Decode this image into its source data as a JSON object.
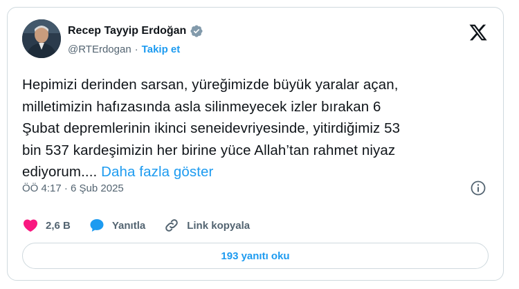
{
  "author": {
    "name": "Recep Tayyip Erdoğan",
    "handle": "@RTErdogan",
    "separator": "·",
    "follow_label": "Takip et"
  },
  "tweet": {
    "text": "Hepimizi derinden sarsan, yüreğimizde büyük yaralar açan,\nmilletimizin hafızasında asla silinmeyecek izler bırakan 6\nŞubat depremlerinin ikinci seneidevriyesinde, yitirdiğimiz 53\nbin 537 kardeşimizin her birine yüce Allah’tan rahmet niyaz\nediyorum....",
    "show_more": "Daha fazla göster",
    "timestamp": "ÖÖ 4:17 · 6 Şub 2025"
  },
  "actions": {
    "likes": "2,6 B",
    "reply_label": "Yanıtla",
    "copy_link_label": "Link kopyala"
  },
  "read_replies": "193 yanıtı oku",
  "icons": {
    "verified": "verified-badge-icon",
    "x_logo": "x-logo-icon",
    "info": "info-icon",
    "heart": "heart-icon",
    "reply": "speech-bubble-icon",
    "link": "link-icon"
  },
  "colors": {
    "accent": "#1d9bf0",
    "heart": "#f91880",
    "text": "#0f1419",
    "muted": "#536471",
    "border": "#cfd9de"
  }
}
